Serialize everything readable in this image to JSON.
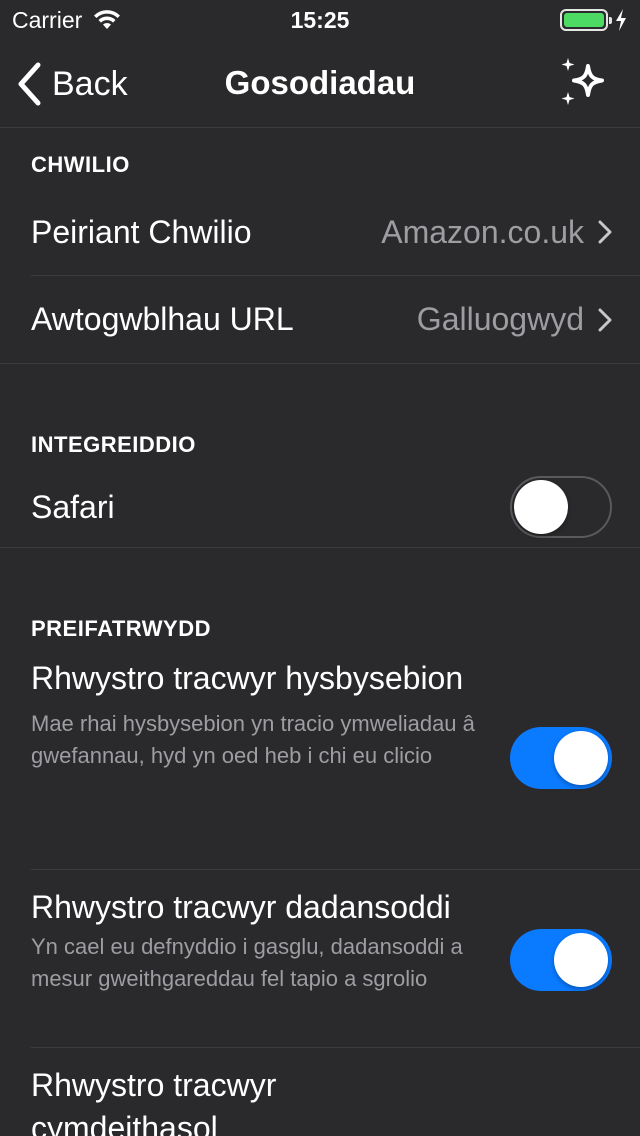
{
  "status": {
    "carrier": "Carrier",
    "time": "15:25"
  },
  "nav": {
    "back_label": "Back",
    "title": "Gosodiadau"
  },
  "search_section": {
    "header": "CHWILIO",
    "rows": [
      {
        "label": "Peiriant Chwilio",
        "value": "Amazon.co.uk"
      },
      {
        "label": "Awtogwblhau URL",
        "value": "Galluogwyd"
      }
    ]
  },
  "integration_section": {
    "header": "INTEGREIDDIO",
    "safari": {
      "label": "Safari",
      "enabled": false
    }
  },
  "privacy_section": {
    "header": "PREIFATRWYDD",
    "items": [
      {
        "title": "Rhwystro tracwyr hysbysebion",
        "description": "Mae rhai hysbysebion yn tracio ymweliadau â gwefannau, hyd yn oed heb i chi eu clicio",
        "enabled": true
      },
      {
        "title": "Rhwystro tracwyr dadansoddi",
        "description": "Yn cael eu defnyddio i gasglu, dadansoddi a mesur gweithgareddau fel tapio a sgrolio",
        "enabled": true
      },
      {
        "title": "Rhwystro tracwyr cymdeithasol"
      }
    ]
  },
  "colors": {
    "accent": "#0a7aff",
    "background": "#2a2a2c",
    "secondary_text": "#9d9da2"
  }
}
